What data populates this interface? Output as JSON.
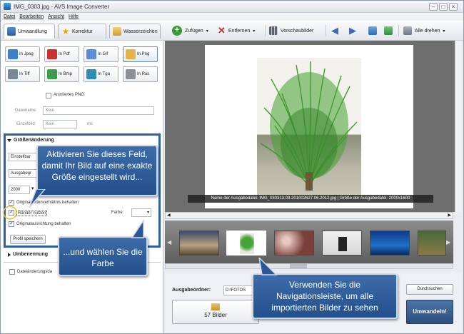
{
  "window": {
    "title": "IMG_0303.jpg - AVS Image Converter"
  },
  "menu": [
    "Datei",
    "Bearbeiten",
    "Ansicht",
    "Hilfe"
  ],
  "tabs": [
    {
      "label": "Umwandlung",
      "icon": "convert-icon"
    },
    {
      "label": "Korrektur",
      "icon": "star-icon"
    },
    {
      "label": "Wasserzeichen",
      "icon": "watermark-icon"
    }
  ],
  "toolbar": {
    "add_label": "Zufügen",
    "remove_label": "Entfernen",
    "preview_label": "Vorschaubilder",
    "rotate_label": "Alle drehen"
  },
  "formats": [
    {
      "label": "In Jpeg",
      "color": "#3b7fc8"
    },
    {
      "label": "In Pdf",
      "color": "#c93030"
    },
    {
      "label": "In Gif",
      "color": "#5b8bd6"
    },
    {
      "label": "In Png",
      "color": "#e6b34a"
    },
    {
      "label": "In Tiff",
      "color": "#7a8796"
    },
    {
      "label": "In Bmp",
      "color": "#3f9a4b"
    },
    {
      "label": "In Tga",
      "color": "#2d8fb3"
    },
    {
      "label": "In Ras",
      "color": "#8a8f98"
    }
  ],
  "options": {
    "animated_png": "Animiertes PNG",
    "filename_label": "Dateiname:",
    "filename_value": "Kein",
    "single_label": "Einzelbild:",
    "single_value": "Kein",
    "single_unit": "ms"
  },
  "resize": {
    "header": "Größenänderung",
    "mode": "Einstellbar",
    "output": "Ausgabegr",
    "width_value": "2000",
    "keep_ratio": "Originalseitenverhältnis behalten",
    "use_border": "Ränder nutzen",
    "color_label": "Farbe:",
    "keep_orientation": "Originalausrichtung behalten",
    "save_profile": "Profil speichern"
  },
  "rename": {
    "header": "Umbenennung"
  },
  "date_change": {
    "label": "Dateiänderungsda"
  },
  "callouts": {
    "resize": "Aktivieren Sie dieses Feld, damit Ihr Bild auf eine exakte Größe eingestellt wird...",
    "color": "...und wählen Sie die Farbe",
    "nav": "Verwenden Sie die Navigationsleiste, um alle importierten Bilder zu sehen"
  },
  "preview": {
    "info": "Name der Ausgabedatei: IMG_030313.09.201002627.06.2012.jpg | Größe der Ausgabedatei: 2000x1600"
  },
  "output": {
    "folder_label": "Ausgabeordner:",
    "folder_value": "D:\\FOTOS",
    "browse": "Durchsuchen",
    "images_count": "57 Bilder",
    "convert": "Umwandeln!"
  },
  "colors": {
    "accent": "#2d5fa5",
    "callout": "#2a5894"
  }
}
